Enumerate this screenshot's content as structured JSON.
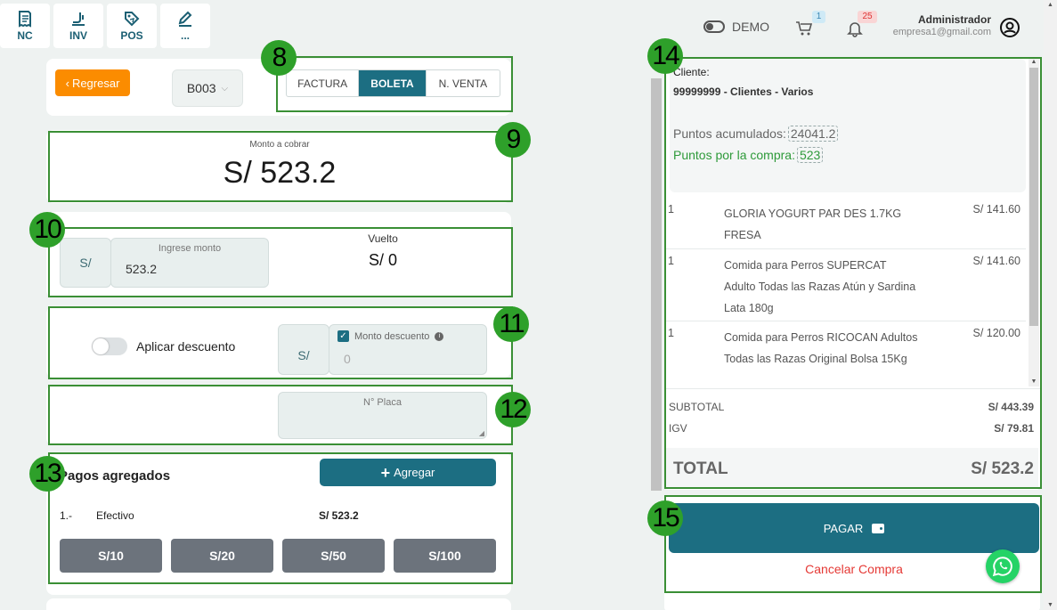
{
  "quick_actions": [
    {
      "label": "NC",
      "icon": "receipt-icon"
    },
    {
      "label": "INV",
      "icon": "inventory-icon"
    },
    {
      "label": "POS",
      "icon": "tag-icon"
    },
    {
      "label": "...",
      "icon": "edit-icon"
    }
  ],
  "header": {
    "demo_label": "DEMO",
    "cart_badge": "1",
    "bell_badge": "25",
    "user_name": "Administrador",
    "user_email": "empresa1@gmail.com"
  },
  "toolbar": {
    "back_label": "Regresar",
    "series_value": "B003",
    "doc_types": [
      "FACTURA",
      "BOLETA",
      "N. VENTA"
    ],
    "active_doc_type": "BOLETA"
  },
  "amount": {
    "label": "Monto a cobrar",
    "value": "S/ 523.2"
  },
  "payment_input": {
    "currency": "S/",
    "label": "Ingrese monto",
    "value": "523.2",
    "change_label": "Vuelto",
    "change_value": "S/ 0"
  },
  "discount": {
    "toggle_label": "Aplicar descuento",
    "currency": "S/",
    "checkbox_label": "Monto descuento",
    "placeholder": "0"
  },
  "plate": {
    "label": "N° Placa"
  },
  "payments": {
    "title": "Pagos agregados",
    "add_label": "Agregar",
    "rows": [
      {
        "index": "1.-",
        "method": "Efectivo",
        "amount": "S/ 523.2"
      }
    ],
    "quick_amounts": [
      "S/10",
      "S/20",
      "S/50",
      "S/100"
    ]
  },
  "summary": {
    "client_label": "Cliente:",
    "client_value": "99999999 - Clientes - Varios",
    "points_acc_label": "Puntos acumulados:",
    "points_acc_value": "24041.2",
    "points_buy_label": "Puntos por la compra:",
    "points_buy_value": "523",
    "items": [
      {
        "qty": "1",
        "desc": "GLORIA YOGURT PAR DES 1.7KG FRESA",
        "price": "S/ 141.60"
      },
      {
        "qty": "1",
        "desc": "Comida para Perros SUPERCAT Adulto Todas las Razas Atún y Sardina Lata 180g",
        "price": "S/ 141.60"
      },
      {
        "qty": "1",
        "desc": "Comida para Perros RICOCAN Adultos Todas las Razas Original Bolsa 15Kg",
        "price": "S/ 120.00"
      }
    ],
    "subtotal_label": "SUBTOTAL",
    "subtotal_value": "S/ 443.39",
    "igv_label": "IGV",
    "igv_value": "S/ 79.81",
    "total_label": "TOTAL",
    "total_value": "S/ 523.2"
  },
  "actions": {
    "pay_label": "PAGAR",
    "cancel_label": "Cancelar Compra"
  },
  "annotations": [
    "8",
    "9",
    "10",
    "11",
    "12",
    "13",
    "14",
    "15"
  ],
  "colors": {
    "primary": "#1c6e82",
    "orange": "#fb8c00",
    "annotation_green": "#2ea02a",
    "points_green": "#2e9a3a",
    "cancel_red": "#e53935",
    "whatsapp": "#25d366"
  }
}
